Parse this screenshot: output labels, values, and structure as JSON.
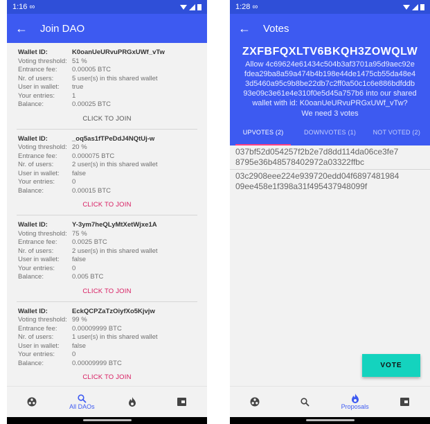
{
  "left_screen": {
    "status_time": "1:16",
    "status_icon": "∞",
    "title": "Join DAO",
    "field_labels": {
      "wallet_id": "Wallet ID:",
      "threshold": "Voting threshold:",
      "fee": "Entrance fee:",
      "users": "Nr. of users:",
      "user_in_wallet": "User in wallet:",
      "entries": "Your entries:",
      "balance": "Balance:"
    },
    "daos": [
      {
        "wallet_id": "K0oanUeURvuPRGxUWf_vTw",
        "threshold": "51 %",
        "fee": "0.00005 BTC",
        "users": "5 user(s) in this shared wallet",
        "user_in_wallet": "true",
        "entries": "1",
        "balance": "0.00025 BTC",
        "join": "CLICK TO JOIN",
        "join_enabled": false
      },
      {
        "wallet_id": "_oq5as1fTPeDdJ4NQtUj-w",
        "threshold": "20 %",
        "fee": "0.000075 BTC",
        "users": "2 user(s) in this shared wallet",
        "user_in_wallet": "false",
        "entries": "0",
        "balance": "0.00015 BTC",
        "join": "CLICK TO JOIN",
        "join_enabled": true
      },
      {
        "wallet_id": "Y-3ym7heQLyMtXetWjxe1A",
        "threshold": "75 %",
        "fee": "0.0025 BTC",
        "users": "2 user(s) in this shared wallet",
        "user_in_wallet": "false",
        "entries": "0",
        "balance": "0.005 BTC",
        "join": "CLICK TO JOIN",
        "join_enabled": true
      },
      {
        "wallet_id": "EckQCPZaTzOiyfXo5Kjvjw",
        "threshold": "99 %",
        "fee": "0.00009999 BTC",
        "users": "1 user(s) in this shared wallet",
        "user_in_wallet": "false",
        "entries": "0",
        "balance": "0.00009999 BTC",
        "join": "CLICK TO JOIN",
        "join_enabled": true
      }
    ],
    "nav": [
      {
        "icon": "trustchain-icon",
        "label": ""
      },
      {
        "icon": "search-icon",
        "label": "All DAOs"
      },
      {
        "icon": "fire-icon",
        "label": ""
      },
      {
        "icon": "wallet-icon",
        "label": ""
      }
    ]
  },
  "right_screen": {
    "status_time": "1:28",
    "status_icon": "∞",
    "title": "Votes",
    "proposal_id": "ZXFBFQXLTV6BKQH3ZOWQLW",
    "request_lines": [
      "Allow 4c69624e61434c504b3af3701a95d9aec92e",
      "fdea29ba8a59a474b4b198e44de1475cb55da48e4",
      "3d5460a95c9b8be22db7c2ff0a50c1c6e886bdfddb",
      "93e09c3e61e4e310f0e5d45a757b6 into our shared",
      "wallet with id: K0oanUeURvuPRGxUWf_vTw?"
    ],
    "need": "We need 3 votes",
    "tabs": [
      "UPVOTES (2)",
      "DOWNVOTES (1)",
      "NOT VOTED (2)"
    ],
    "votes": [
      [
        "037bf52d054257f2b2e7d8dd114da06ce3fe7",
        "8795e36b48578402972a03322ffbc"
      ],
      [
        "03c2908eee224e939720edd04f6897481984",
        "09ee458e1f398a31f495437948099f"
      ]
    ],
    "vote_button": "VOTE",
    "nav": [
      {
        "icon": "trustchain-icon",
        "label": ""
      },
      {
        "icon": "search-icon",
        "label": ""
      },
      {
        "icon": "fire-icon",
        "label": "Proposals"
      },
      {
        "icon": "wallet-icon",
        "label": ""
      }
    ]
  },
  "colors": {
    "primary": "#3d5af1",
    "status": "#2f4fd8",
    "accent": "#ff4081",
    "join": "#d81b60",
    "fab": "#14d3be"
  }
}
